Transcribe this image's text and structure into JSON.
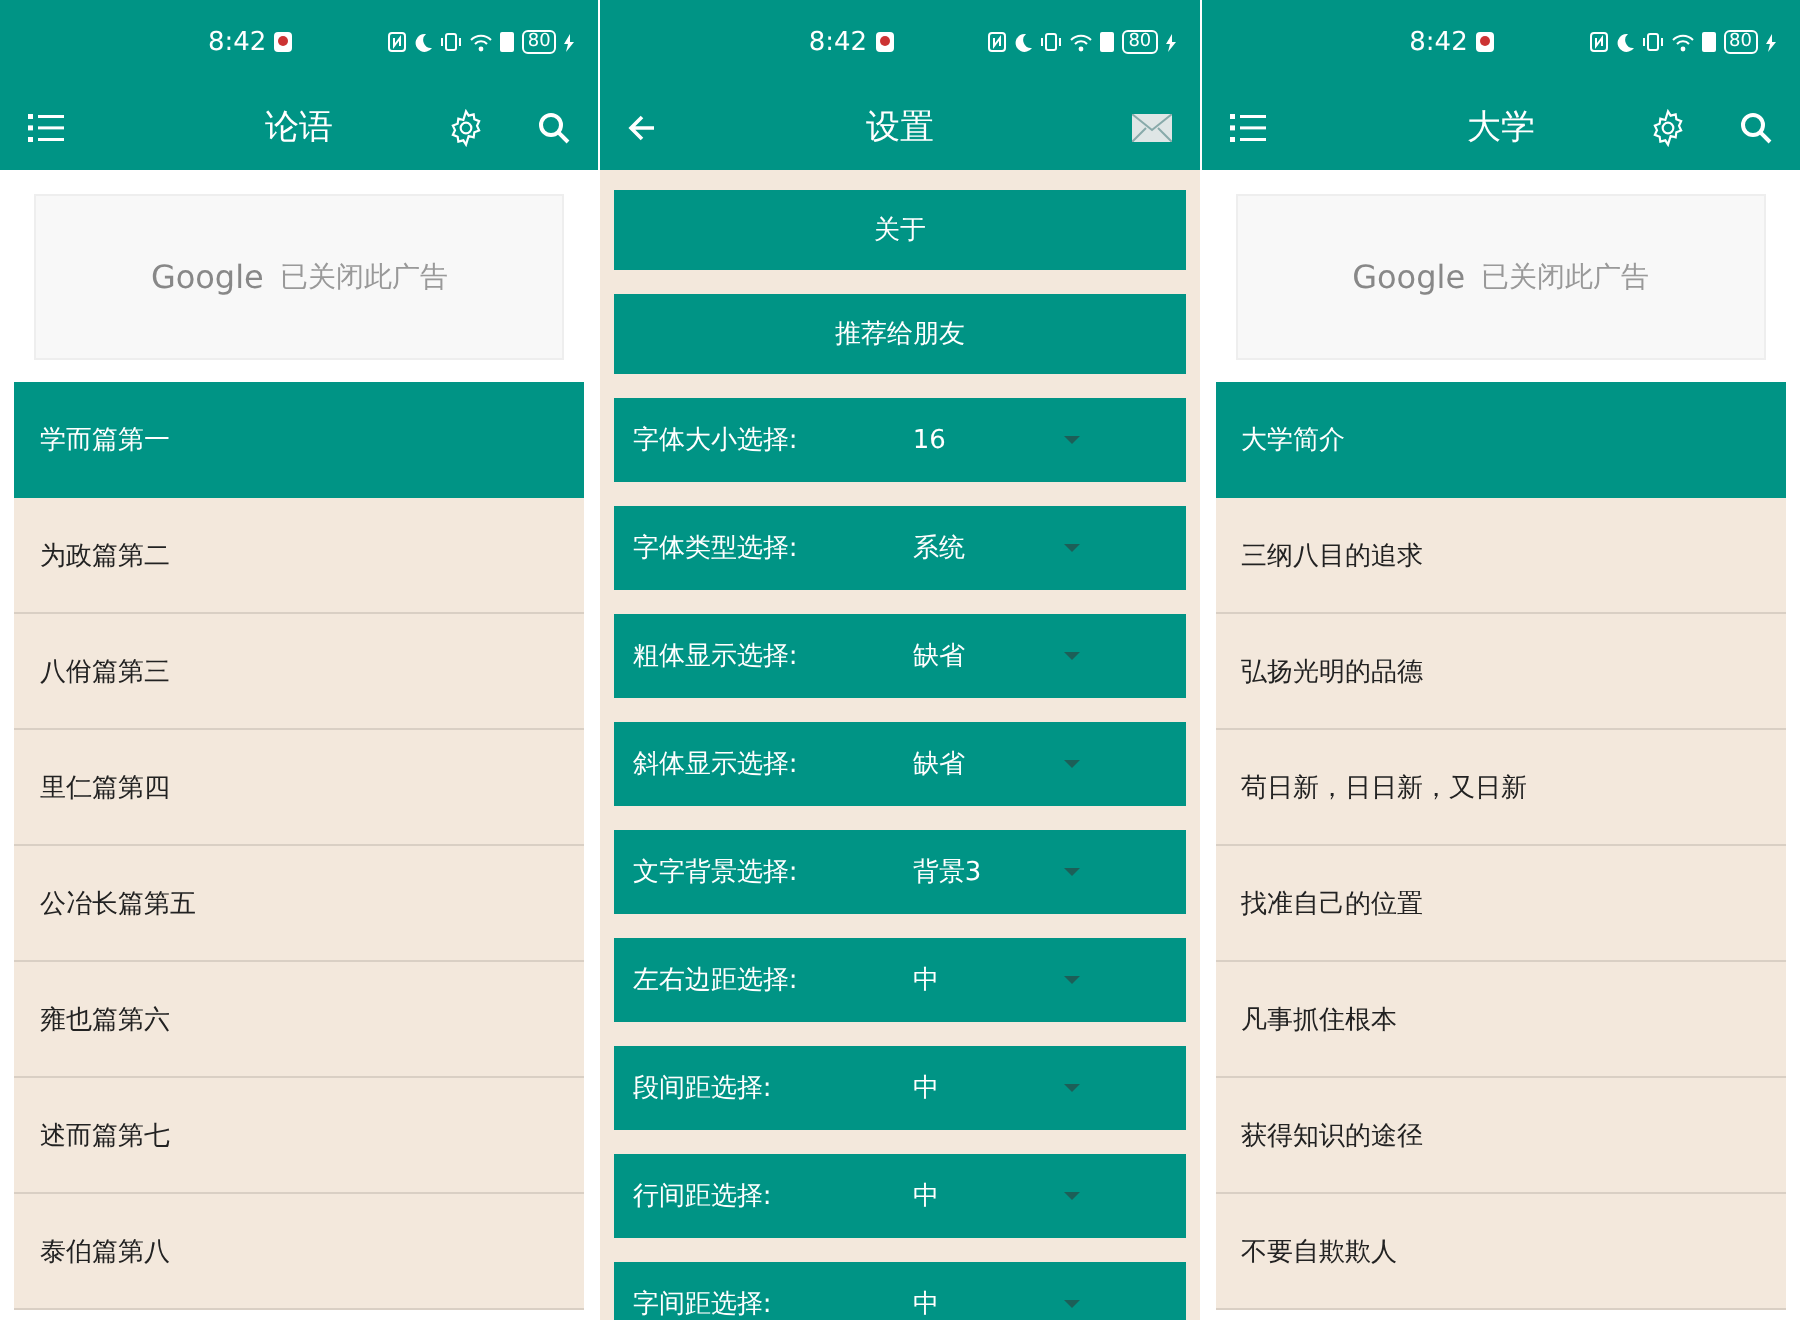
{
  "panels": [
    {
      "kind": "book",
      "status_bar": {
        "time": "8:42",
        "battery": "80"
      },
      "title": "论语",
      "ad": {
        "brand": "Google",
        "text": "已关闭此广告"
      },
      "items": [
        {
          "label": "学而篇第一",
          "selected": true
        },
        {
          "label": "为政篇第二",
          "selected": false
        },
        {
          "label": "八佾篇第三",
          "selected": false
        },
        {
          "label": "里仁篇第四",
          "selected": false
        },
        {
          "label": "公冶长篇第五",
          "selected": false
        },
        {
          "label": "雍也篇第六",
          "selected": false
        },
        {
          "label": "述而篇第七",
          "selected": false
        },
        {
          "label": "泰伯篇第八",
          "selected": false
        }
      ]
    },
    {
      "kind": "settings",
      "status_bar": {
        "time": "8:42",
        "battery": "80"
      },
      "title": "设置",
      "buttons": [
        "关于",
        "推荐给朋友"
      ],
      "options": [
        {
          "label": "字体大小选择:",
          "value": "16"
        },
        {
          "label": "字体类型选择:",
          "value": "系统"
        },
        {
          "label": "粗体显示选择:",
          "value": "缺省"
        },
        {
          "label": "斜体显示选择:",
          "value": "缺省"
        },
        {
          "label": "文字背景选择:",
          "value": "背景3"
        },
        {
          "label": "左右边距选择:",
          "value": "中"
        },
        {
          "label": "段间距选择:",
          "value": "中"
        },
        {
          "label": "行间距选择:",
          "value": "中"
        },
        {
          "label": "字间距选择:",
          "value": "中"
        }
      ]
    },
    {
      "kind": "book",
      "status_bar": {
        "time": "8:42",
        "battery": "80"
      },
      "title": "大学",
      "ad": {
        "brand": "Google",
        "text": "已关闭此广告"
      },
      "items": [
        {
          "label": "大学简介",
          "selected": true
        },
        {
          "label": "三纲八目的追求",
          "selected": false
        },
        {
          "label": "弘扬光明的品德",
          "selected": false
        },
        {
          "label": "苟日新，日日新，又日新",
          "selected": false
        },
        {
          "label": "找准自己的位置",
          "selected": false
        },
        {
          "label": "凡事抓住根本",
          "selected": false
        },
        {
          "label": "获得知识的途径",
          "selected": false
        },
        {
          "label": "不要自欺欺人",
          "selected": false
        }
      ]
    }
  ]
}
